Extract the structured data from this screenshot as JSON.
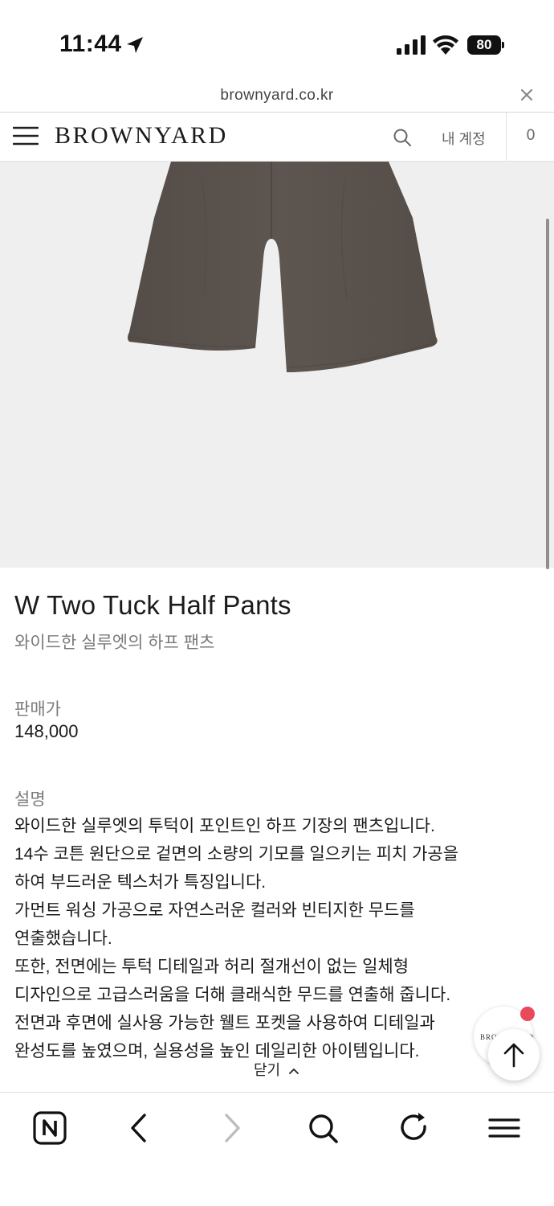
{
  "status_bar": {
    "time": "11:44",
    "battery": "80"
  },
  "url_bar": {
    "domain": "brownyard.co.kr"
  },
  "header": {
    "brand": "BROWNYARD",
    "account_label": "내 계정",
    "cart_count": "0"
  },
  "product": {
    "title": "W Two Tuck Half Pants",
    "subtitle": "와이드한 실루엣의 하프 팬츠",
    "price_label": "판매가",
    "price": "148,000",
    "description_label": "설명",
    "description_lines": [
      "와이드한 실루엣의 투턱이 포인트인 하프 기장의 팬츠입니다.",
      "14수 코튼 원단으로 겉면의 소량의 기모를 일으키는 피치 가공을",
      "하여 부드러운 텍스처가 특징입니다.",
      "가먼트 워싱 가공으로 자연스러운 컬러와 빈티지한 무드를",
      "연출했습니다.",
      "또한, 전면에는 투턱 디테일과 허리 절개선이 없는 일체형",
      "디자인으로 고급스러움을 더해 클래식한 무드를 연출해 줍니다.",
      "전면과 후면에 실사용 가능한 웰트 포켓을 사용하여 디테일과",
      "완성도를 높였으며, 실용성을 높인 데일리한 아이템입니다."
    ]
  },
  "collapse_label": "닫기",
  "floating": {
    "brand_badge": "BROWNYARD"
  },
  "colors": {
    "pants": "#5b534e",
    "image_bg": "#efefef",
    "notification": "#e84a5a"
  },
  "icons": [
    "location-arrow-icon",
    "signal-icon",
    "wifi-icon",
    "battery-icon",
    "close-icon",
    "hamburger-menu-icon",
    "search-icon",
    "chevron-up-icon",
    "arrow-up-icon",
    "naver-n-icon",
    "back-chevron-icon",
    "forward-chevron-icon",
    "refresh-icon",
    "menu-icon"
  ]
}
